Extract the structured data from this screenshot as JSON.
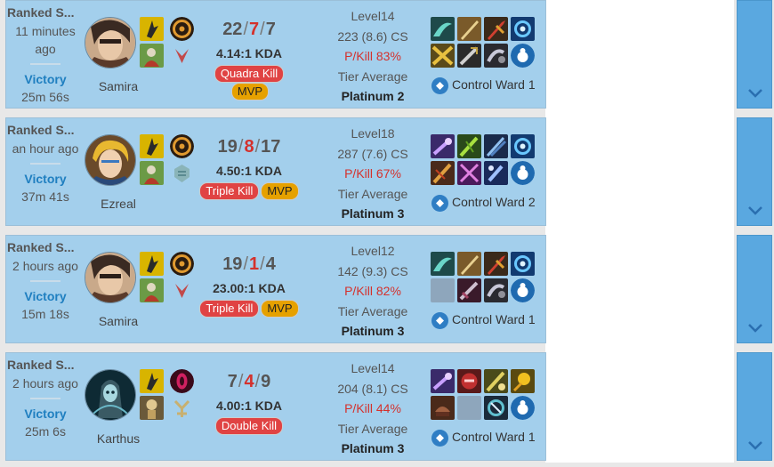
{
  "matches": [
    {
      "game_type": "Ranked S...",
      "time_ago": "11 minutes ago",
      "result": "Victory",
      "duration": "25m 56s",
      "champion": "Samira",
      "kills": "22",
      "deaths": "7",
      "assists": "7",
      "kda_ratio": "4.14:1 KDA",
      "multikill": "Quadra Kill",
      "mvp": "MVP",
      "level": "Level14",
      "cs": "223 (8.6) CS",
      "pkill": "P/Kill 83%",
      "tier_label": "Tier Average",
      "tier": "Platinum 2",
      "ward": "Control Ward 1"
    },
    {
      "game_type": "Ranked S...",
      "time_ago": "an hour ago",
      "result": "Victory",
      "duration": "37m 41s",
      "champion": "Ezreal",
      "kills": "19",
      "deaths": "8",
      "assists": "17",
      "kda_ratio": "4.50:1 KDA",
      "multikill": "Triple Kill",
      "mvp": "MVP",
      "level": "Level18",
      "cs": "287 (7.6) CS",
      "pkill": "P/Kill 67%",
      "tier_label": "Tier Average",
      "tier": "Platinum 3",
      "ward": "Control Ward 2"
    },
    {
      "game_type": "Ranked S...",
      "time_ago": "2 hours ago",
      "result": "Victory",
      "duration": "15m 18s",
      "champion": "Samira",
      "kills": "19",
      "deaths": "1",
      "assists": "4",
      "kda_ratio": "23.00:1 KDA",
      "multikill": "Triple Kill",
      "mvp": "MVP",
      "level": "Level12",
      "cs": "142 (9.3) CS",
      "pkill": "P/Kill 82%",
      "tier_label": "Tier Average",
      "tier": "Platinum 3",
      "ward": "Control Ward 1"
    },
    {
      "game_type": "Ranked S...",
      "time_ago": "2 hours ago",
      "result": "Victory",
      "duration": "25m 6s",
      "champion": "Karthus",
      "kills": "7",
      "deaths": "4",
      "assists": "9",
      "kda_ratio": "4.00:1 KDA",
      "multikill": "Double Kill",
      "mvp": "",
      "level": "Level14",
      "cs": "204 (8.1) CS",
      "pkill": "P/Kill 44%",
      "tier_label": "Tier Average",
      "tier": "Platinum 3",
      "ward": "Control Ward 1"
    }
  ],
  "colors": {
    "row_bg": "#a3cfec",
    "expand_bg": "#5aa8e0",
    "victory": "#1f7fc0",
    "deaths": "#d4312c",
    "multikill_badge": "#e04343",
    "mvp_badge": "#e6a100"
  }
}
